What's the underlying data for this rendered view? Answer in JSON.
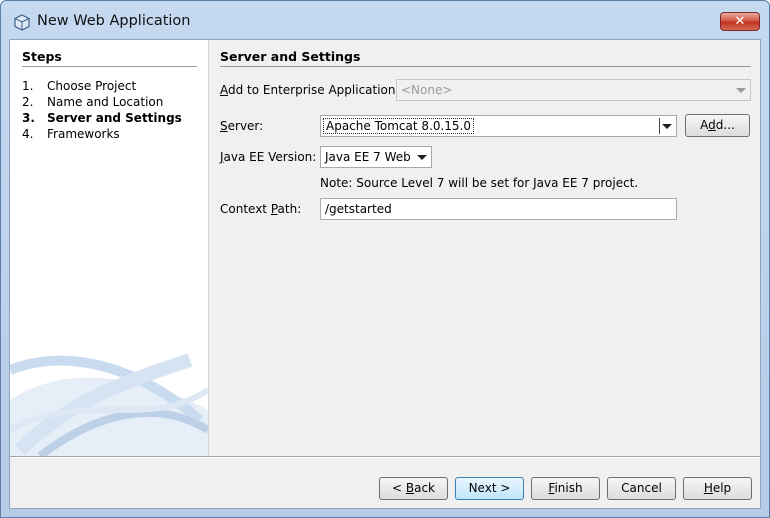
{
  "window": {
    "title": "New Web Application",
    "close_label": "✕"
  },
  "steps": {
    "title": "Steps",
    "items": [
      {
        "num": "1.",
        "label": "Choose Project"
      },
      {
        "num": "2.",
        "label": "Name and Location"
      },
      {
        "num": "3.",
        "label": "Server and Settings"
      },
      {
        "num": "4.",
        "label": "Frameworks"
      }
    ]
  },
  "form": {
    "title": "Server and Settings",
    "enterprise": {
      "label_mn": "A",
      "label_rest": "dd to Enterprise Application:",
      "value": "<None>"
    },
    "server": {
      "label_mn": "S",
      "label_rest": "erver:",
      "value": "Apache Tomcat 8.0.15.0",
      "add_label_pre": "A",
      "add_label_mn": "d",
      "add_label_post": "d..."
    },
    "javaee": {
      "label_mn": "J",
      "label_rest": "ava EE Version:",
      "value": "Java EE 7 Web"
    },
    "note": "Note: Source Level 7 will be set for Java EE 7 project.",
    "context": {
      "label_pre": "Context ",
      "label_mn": "P",
      "label_rest": "ath:",
      "value": "/getstarted"
    }
  },
  "buttons": {
    "back_pre": "< ",
    "back_mn": "B",
    "back_post": "ack",
    "next": "Next >",
    "finish_mn": "F",
    "finish_post": "inish",
    "cancel": "Cancel",
    "help_mn": "H",
    "help_post": "elp"
  }
}
